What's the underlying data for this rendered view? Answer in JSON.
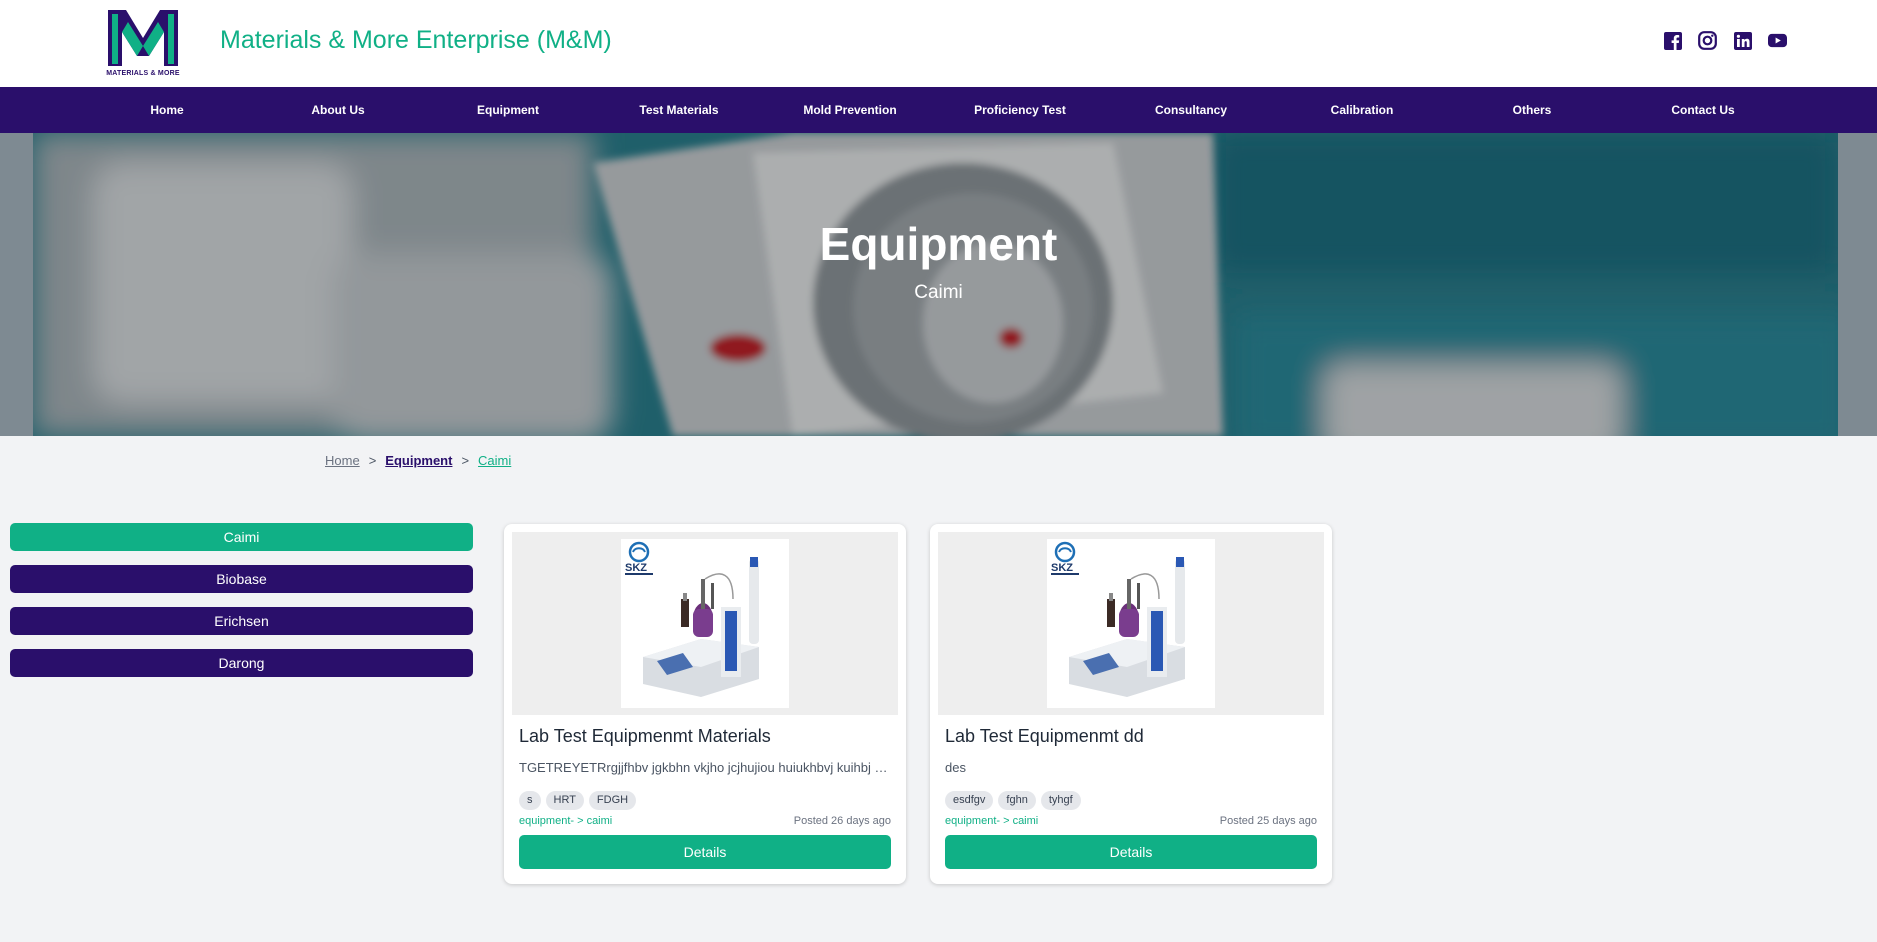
{
  "header": {
    "logo_text": "MATERIALS & MORE",
    "brand_name": "Materials & More Enterprise (M&M)",
    "socials": [
      "facebook-icon",
      "instagram-icon",
      "linkedin-icon",
      "youtube-icon"
    ]
  },
  "nav": {
    "items": [
      {
        "label": "Home"
      },
      {
        "label": "About Us"
      },
      {
        "label": "Equipment"
      },
      {
        "label": "Test Materials"
      },
      {
        "label": "Mold Prevention"
      },
      {
        "label": "Proficiency Test"
      },
      {
        "label": "Consultancy"
      },
      {
        "label": "Calibration"
      },
      {
        "label": "Others"
      },
      {
        "label": "Contact Us"
      }
    ]
  },
  "hero": {
    "title": "Equipment",
    "subtitle": "Caimi"
  },
  "breadcrumb": {
    "home": "Home",
    "separator": ">",
    "section": "Equipment",
    "current": "Caimi"
  },
  "sidebar": {
    "categories": [
      {
        "label": "Caimi",
        "active": true
      },
      {
        "label": "Biobase",
        "active": false
      },
      {
        "label": "Erichsen",
        "active": false
      },
      {
        "label": "Darong",
        "active": false
      }
    ]
  },
  "products": [
    {
      "title": "Lab Test Equipmenmt Materials",
      "description": "TGETREYETRrgjjfhbv jgkbhn vkjho jcjhujiou huiukhbvj kuihbj vkjhb",
      "tags": [
        "s",
        "HRT",
        "FDGH"
      ],
      "path": "equipment- > caimi",
      "posted": "Posted 26 days ago",
      "button": "Details",
      "image_brand": "SKZ"
    },
    {
      "title": "Lab Test Equipmenmt dd",
      "description": "des",
      "tags": [
        "esdfgv",
        "fghn",
        "tyhgf"
      ],
      "path": "equipment- > caimi",
      "posted": "Posted 25 days ago",
      "button": "Details",
      "image_brand": "SKZ"
    }
  ],
  "colors": {
    "primary_purple": "#2a0f6b",
    "accent_green": "#10b086",
    "page_background": "#f2f3f5"
  }
}
